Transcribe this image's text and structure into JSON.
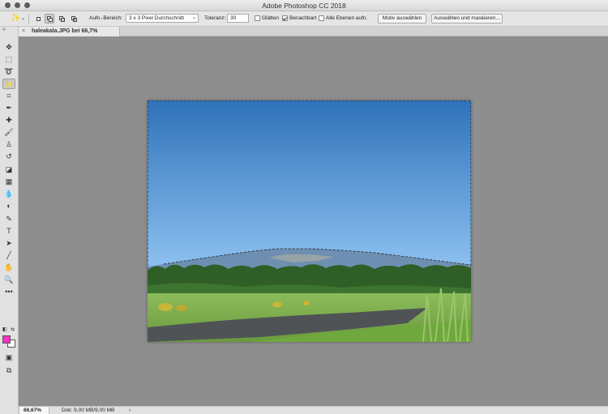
{
  "window": {
    "title": "Adobe Photoshop CC 2018"
  },
  "options_bar": {
    "tool_icon": "magic-wand-icon",
    "sample_size_label": "Aufn.-Bereich:",
    "sample_size_value": "3 x 3 Pixel Durchschnitt",
    "tolerance_label": "Toleranz:",
    "tolerance_value": "30",
    "antialias_label": "Glätten",
    "antialias_checked": false,
    "contiguous_label": "Benachbart",
    "contiguous_checked": true,
    "all_layers_label": "Alle Ebenen aufn.",
    "all_layers_checked": false,
    "select_subject_label": "Motiv auswählen",
    "select_mask_label": "Auswählen und maskieren..."
  },
  "document_tab": {
    "close_glyph": "×",
    "title": "haleakala.JPG bei 66,7% (RGB/8)"
  },
  "toolbar": {
    "collapse_glyph": "»",
    "tools": [
      {
        "icon": "move-icon",
        "glyph": "✥"
      },
      {
        "icon": "rectangular-marquee-icon",
        "glyph": "⬚"
      },
      {
        "icon": "lasso-icon",
        "glyph": "➰"
      },
      {
        "icon": "magic-wand-icon",
        "glyph": "✨",
        "active": true
      },
      {
        "icon": "crop-icon",
        "glyph": "⌗"
      },
      {
        "icon": "eyedropper-icon",
        "glyph": "✒"
      },
      {
        "icon": "healing-brush-icon",
        "glyph": "✚"
      },
      {
        "icon": "brush-icon",
        "glyph": "🖌"
      },
      {
        "icon": "clone-stamp-icon",
        "glyph": "♙"
      },
      {
        "icon": "history-brush-icon",
        "glyph": "↺"
      },
      {
        "icon": "eraser-icon",
        "glyph": "◪"
      },
      {
        "icon": "gradient-icon",
        "glyph": "▦"
      },
      {
        "icon": "blur-icon",
        "glyph": "💧"
      },
      {
        "icon": "dodge-icon",
        "glyph": "◐"
      },
      {
        "icon": "pen-icon",
        "glyph": "✎"
      },
      {
        "icon": "type-icon",
        "glyph": "T"
      },
      {
        "icon": "path-selection-icon",
        "glyph": "➤"
      },
      {
        "icon": "line-icon",
        "glyph": "╱"
      },
      {
        "icon": "hand-icon",
        "glyph": "✋"
      },
      {
        "icon": "zoom-icon",
        "glyph": "🔍"
      },
      {
        "icon": "more-tools-icon",
        "glyph": "•••"
      }
    ],
    "foreground_color": "#ff2ec4",
    "background_color": "#ffffff"
  },
  "status_bar": {
    "zoom": "66,67%",
    "doc_info": "Dok: 9,00 MB/9,00 MB",
    "arrow_glyph": "›"
  },
  "colors": {
    "sky_top": "#2f72b9",
    "sky_bottom": "#8ec2f1",
    "grass": "#7cab4f",
    "road": "#4f5356"
  }
}
